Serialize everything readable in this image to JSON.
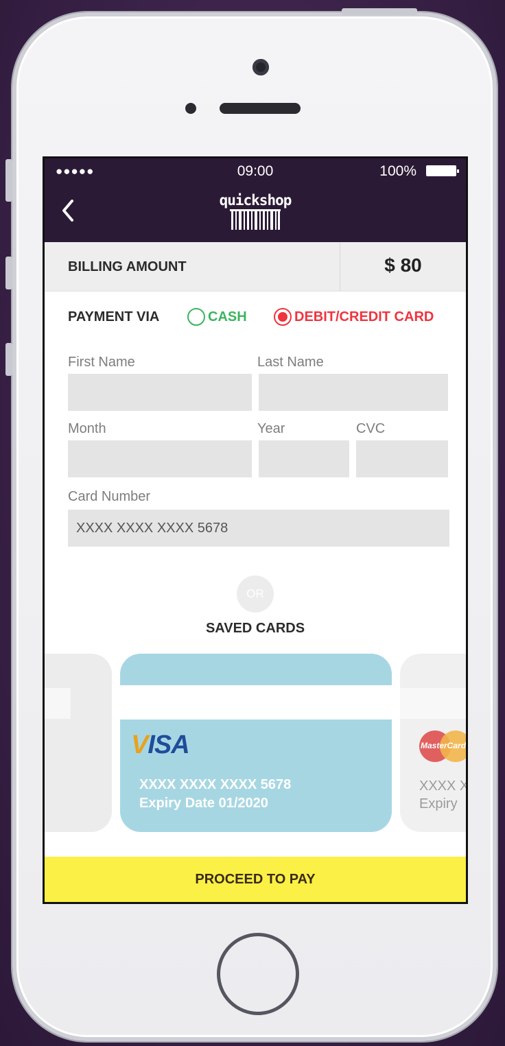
{
  "status_bar": {
    "signal": "●●●●●",
    "time": "09:00",
    "battery": "100%"
  },
  "nav": {
    "back_icon": "chevron-left-icon",
    "logo_text": "quickshop"
  },
  "billing": {
    "label": "BILLING AMOUNT",
    "amount": "$ 80"
  },
  "payment": {
    "label": "PAYMENT VIA",
    "options": [
      {
        "label": "CASH",
        "selected": false,
        "color": "#3bb55e"
      },
      {
        "label": "DEBIT/CREDIT CARD",
        "selected": true,
        "color": "#f0343e"
      }
    ]
  },
  "form": {
    "first_name_label": "First Name",
    "first_name_value": "",
    "last_name_label": "Last Name",
    "last_name_value": "",
    "month_label": "Month",
    "month_value": "",
    "year_label": "Year",
    "year_value": "",
    "cvc_label": "CVC",
    "cvc_value": "",
    "card_number_label": "Card Number",
    "card_number_value": "XXXX XXXX XXXX 5678"
  },
  "divider": {
    "or": "OR",
    "saved_cards": "SAVED CARDS"
  },
  "saved_cards": [
    {
      "brand": "VISA",
      "number": "XXXX XXXX XXXX 5678",
      "expiry": "Expiry Date 01/2020",
      "color": "#a7d6e3"
    },
    {
      "brand": "MasterCard",
      "number": "XXXX X",
      "expiry": "Expiry"
    }
  ],
  "actions": {
    "proceed": "PROCEED TO PAY"
  },
  "colors": {
    "header_bg": "#2b1a36",
    "proceed_bg": "#fbf045",
    "field_bg": "#e4e4e4"
  }
}
